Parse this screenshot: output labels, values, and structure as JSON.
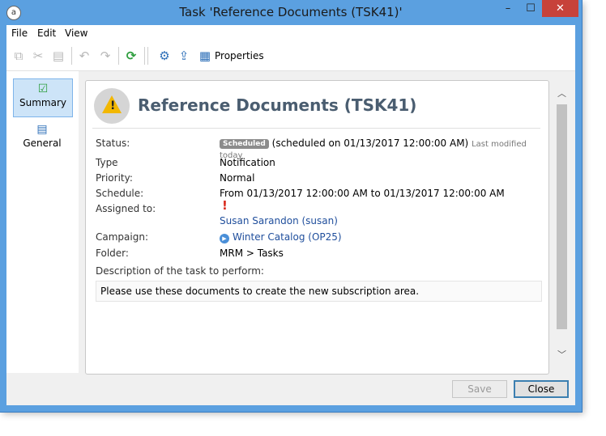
{
  "window": {
    "title": "Task 'Reference Documents (TSK41)'",
    "app_icon": "adobe-campaign-icon"
  },
  "window_controls": {
    "minimize": "–",
    "maximize": "☐",
    "close": "✕"
  },
  "menu": [
    "File",
    "Edit",
    "View"
  ],
  "toolbar": {
    "icons": [
      "copy-icon",
      "cut-icon",
      "paste-icon",
      "undo-icon",
      "redo-icon",
      "refresh-icon",
      "settings-icon",
      "export-icon",
      "properties-icon"
    ],
    "properties_label": "Properties"
  },
  "nav": [
    {
      "label": "Summary",
      "icon": "checkbox-icon",
      "selected": true
    },
    {
      "label": "General",
      "icon": "clipboard-icon",
      "selected": false
    }
  ],
  "summary": {
    "heading": "Reference Documents (TSK41)",
    "status_label": "Status:",
    "status_badge": "Scheduled",
    "status_text": "(scheduled on 01/13/2017 12:00:00 AM)",
    "last_modified": "Last modified today",
    "type_label": "Type",
    "type_value": "Notification",
    "priority_label": "Priority:",
    "priority_value": "Normal",
    "schedule_label": "Schedule:",
    "schedule_value": "From 01/13/2017 12:00:00 AM to 01/13/2017 12:00:00 AM",
    "assigned_label": "Assigned to:",
    "assigned_value": "Susan Sarandon (susan)",
    "campaign_label": "Campaign:",
    "campaign_name": "Winter Catalog",
    "campaign_code": "(OP25)",
    "folder_label": "Folder:",
    "folder_value": "MRM > Tasks",
    "description_label": "Description of the task to perform:",
    "description_value": "Please use these documents to create the new subscription area."
  },
  "buttons": {
    "save": "Save",
    "close": "Close"
  },
  "colors": {
    "accent": "#5ba0e0",
    "title_text": "#4a5d70",
    "link": "#1f4e9c",
    "warning": "#f2b700"
  }
}
